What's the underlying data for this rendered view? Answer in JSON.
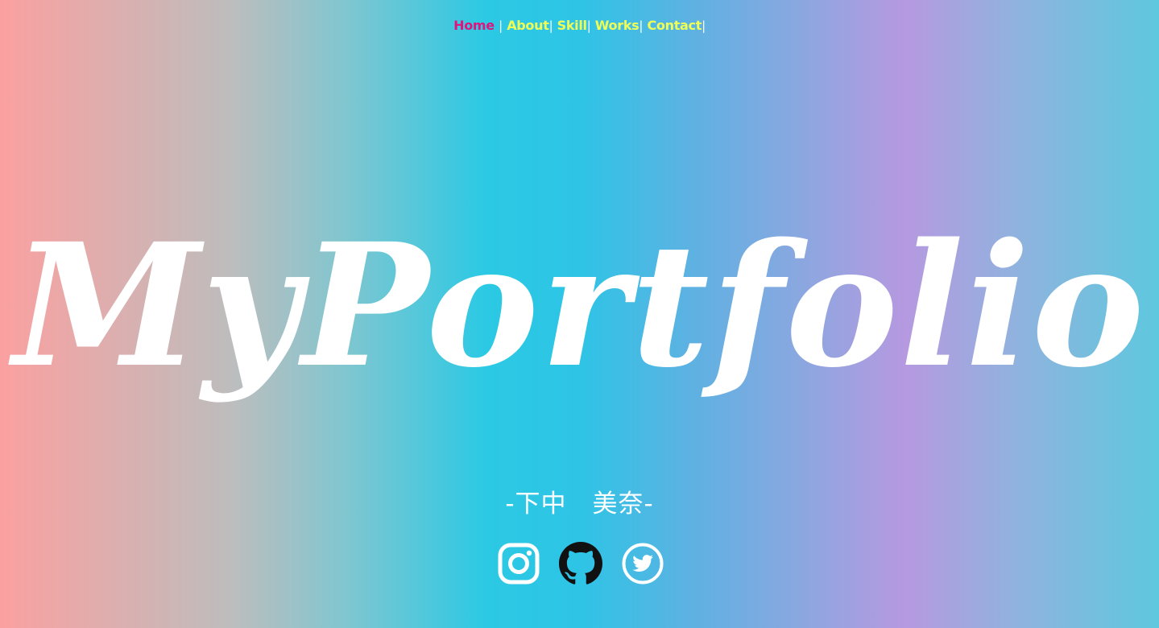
{
  "nav": {
    "items": [
      {
        "label": "Home",
        "color": "#e0147d"
      },
      {
        "label": "About",
        "color": "#eeff55"
      },
      {
        "label": "Skill",
        "color": "#eeff55"
      },
      {
        "label": "Works",
        "color": "#eeff55"
      },
      {
        "label": "Contact",
        "color": "#eeff55"
      }
    ],
    "separator": "|"
  },
  "hero": {
    "title": "MyPortfolio"
  },
  "author": {
    "name": "-下中　美奈-"
  },
  "social": [
    {
      "icon": "instagram-icon",
      "color": "#ffffff"
    },
    {
      "icon": "github-icon",
      "color": "#111111"
    },
    {
      "icon": "twitter-icon",
      "color": "#ffffff"
    }
  ]
}
